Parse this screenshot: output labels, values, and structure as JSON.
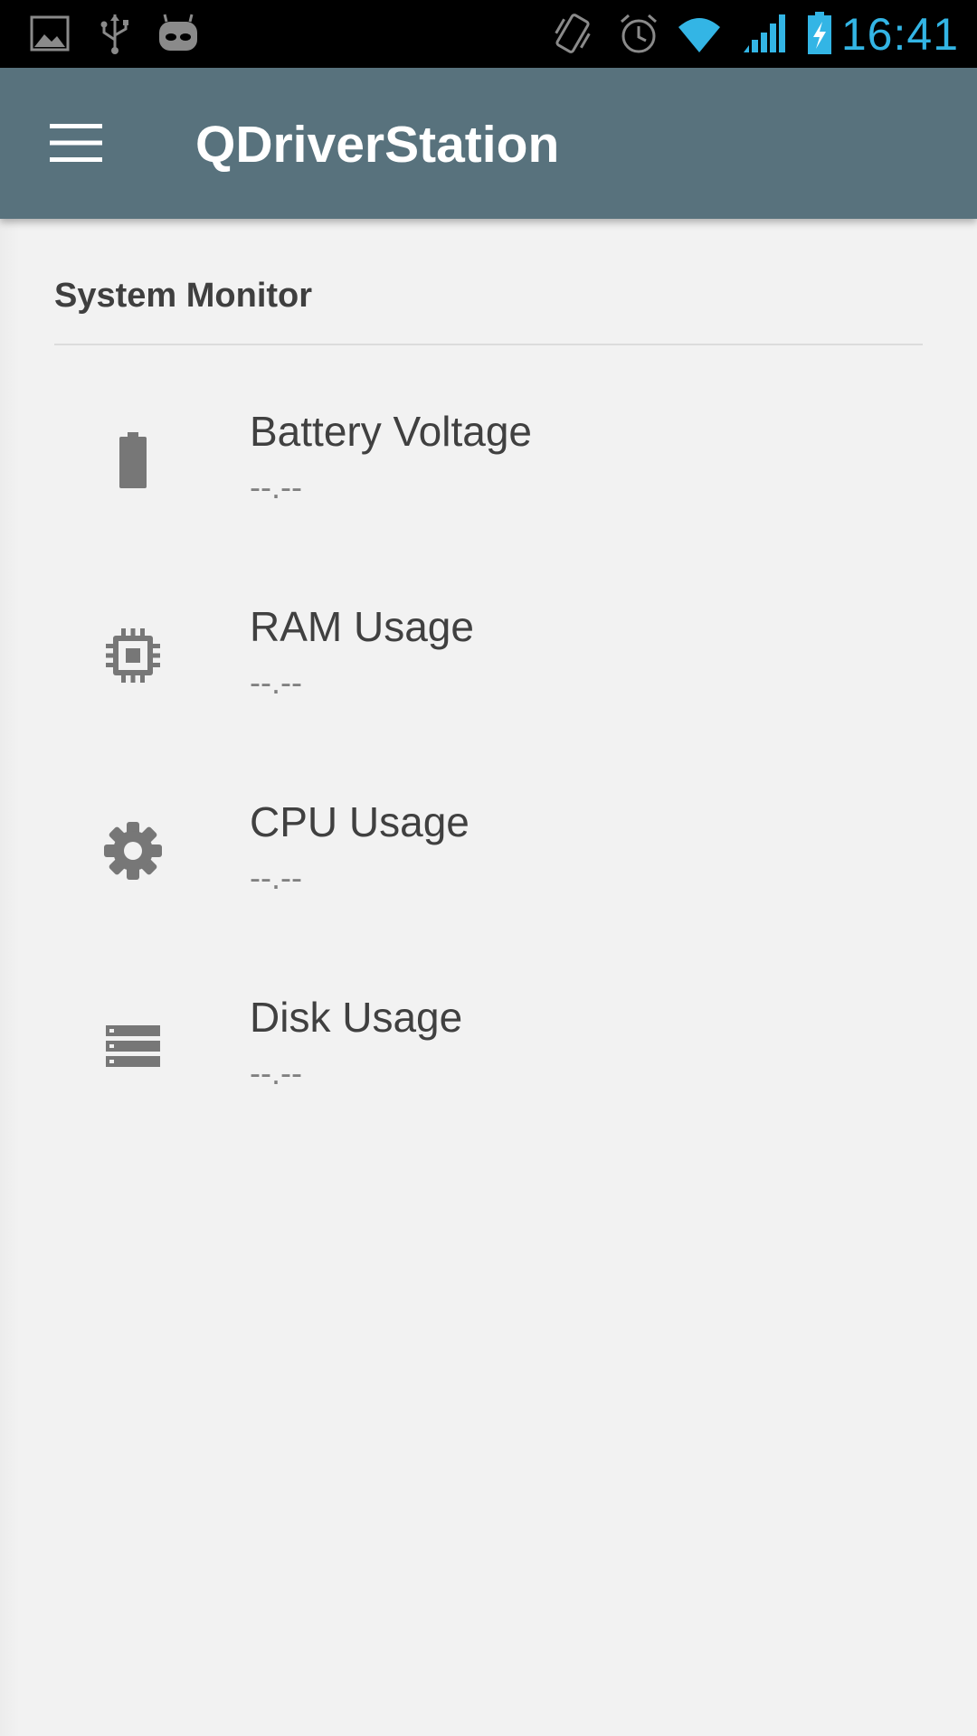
{
  "status_bar": {
    "time": "16:41",
    "icons": [
      "image-icon",
      "usb-icon",
      "cyanogenmod-icon",
      "vibrate-icon",
      "alarm-icon",
      "wifi-icon",
      "cell-signal-icon",
      "battery-charging-icon"
    ],
    "time_color": "#33b5e5"
  },
  "app_bar": {
    "title": "QDriverStation",
    "menu_icon": "hamburger-menu-icon",
    "color": "#58727d"
  },
  "section": {
    "title": "System Monitor"
  },
  "items": [
    {
      "icon": "battery-icon",
      "title": "Battery Voltage",
      "value": "--.--"
    },
    {
      "icon": "memory-chip-icon",
      "title": "RAM Usage",
      "value": "--.--"
    },
    {
      "icon": "gear-icon",
      "title": "CPU Usage",
      "value": "--.--"
    },
    {
      "icon": "storage-icon",
      "title": "Disk Usage",
      "value": "--.--"
    }
  ]
}
